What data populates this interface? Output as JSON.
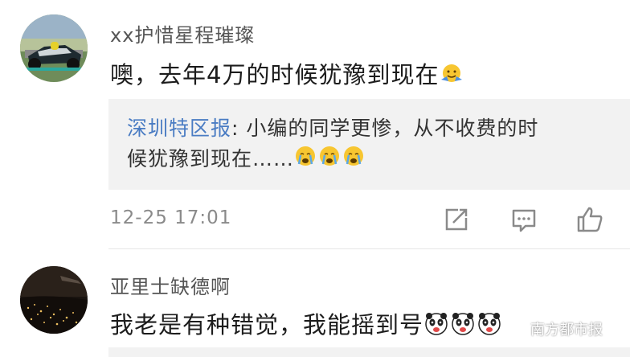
{
  "comments": [
    {
      "username": "xx护惜星程璀璨",
      "text": "噢，去年4万的时候犹豫到现在",
      "emoji": "hug-emoji",
      "reply": {
        "author": "深圳特区报",
        "separator": ": ",
        "text_line1": "小编的同学更惨，从不收费的时",
        "text_line2": "候犹豫到现在……",
        "emoji": "crying-emoji"
      },
      "timestamp": "12-25 17:01"
    },
    {
      "username": "亚里士缺德啊",
      "text": "我老是有种错觉，我能摇到号",
      "emoji": "panda-emoji"
    }
  ],
  "watermark": {
    "text": "南方都市报"
  },
  "colors": {
    "link": "#4a7cc3",
    "reply_bg": "#f2f2f2",
    "meta": "#8a8a8a"
  }
}
